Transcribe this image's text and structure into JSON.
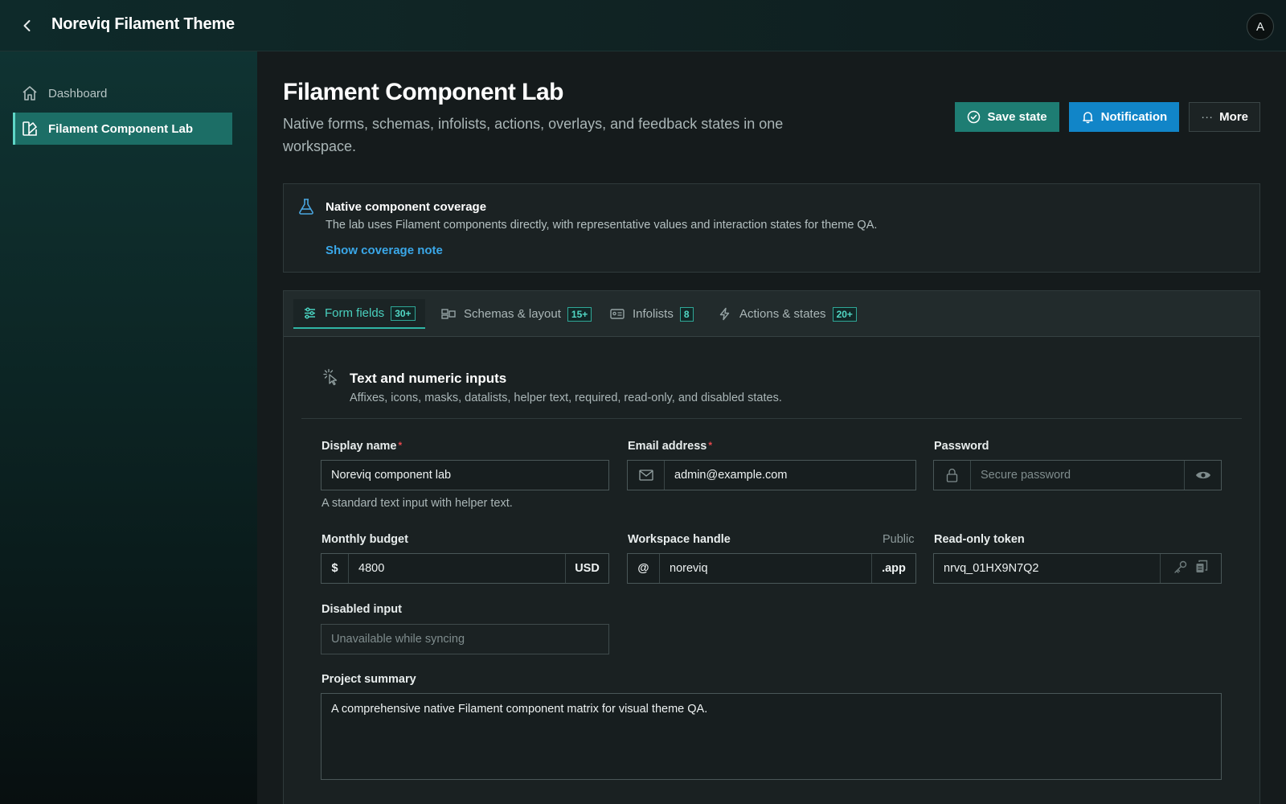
{
  "header": {
    "title": "Noreviq Filament Theme",
    "avatar_initial": "A"
  },
  "sidebar": {
    "items": [
      {
        "label": "Dashboard",
        "icon": "home-icon",
        "active": false
      },
      {
        "label": "Filament Component Lab",
        "icon": "palette-icon",
        "active": true
      }
    ]
  },
  "page": {
    "title": "Filament Component Lab",
    "subtitle": "Native forms, schemas, infolists, actions, overlays, and feedback states in one workspace.",
    "actions": {
      "save_label": "Save state",
      "notification_label": "Notification",
      "more_label": "More"
    }
  },
  "callout": {
    "title": "Native component coverage",
    "text": "The lab uses Filament components directly, with representative values and interaction states for theme QA.",
    "link": "Show coverage note"
  },
  "tabs": [
    {
      "label": "Form fields",
      "count": "30+",
      "icon": "sliders-icon",
      "active": true
    },
    {
      "label": "Schemas & layout",
      "count": "15+",
      "icon": "layout-icon",
      "active": false
    },
    {
      "label": "Infolists",
      "count": "8",
      "icon": "id-card-icon",
      "active": false
    },
    {
      "label": "Actions & states",
      "count": "20+",
      "icon": "bolt-icon",
      "active": false
    }
  ],
  "section": {
    "title": "Text and numeric inputs",
    "description": "Affixes, icons, masks, datalists, helper text, required, read-only, and disabled states."
  },
  "fields": {
    "display_name": {
      "label": "Display name",
      "required": true,
      "value": "Noreviq component lab",
      "help": "A standard text input with helper text."
    },
    "email": {
      "label": "Email address",
      "required": true,
      "value": "admin@example.com"
    },
    "password": {
      "label": "Password",
      "placeholder": "Secure password"
    },
    "budget": {
      "label": "Monthly budget",
      "prefix": "$",
      "value": "4800",
      "suffix": "USD"
    },
    "handle": {
      "label": "Workspace handle",
      "hint": "Public",
      "prefix": "@",
      "value": "noreviq",
      "suffix": ".app"
    },
    "token": {
      "label": "Read-only token",
      "value": "nrvq_01HX9N7Q2"
    },
    "disabled": {
      "label": "Disabled input",
      "placeholder": "Unavailable while syncing"
    },
    "summary": {
      "label": "Project summary",
      "value": "A comprehensive native Filament component matrix for visual theme QA."
    }
  }
}
